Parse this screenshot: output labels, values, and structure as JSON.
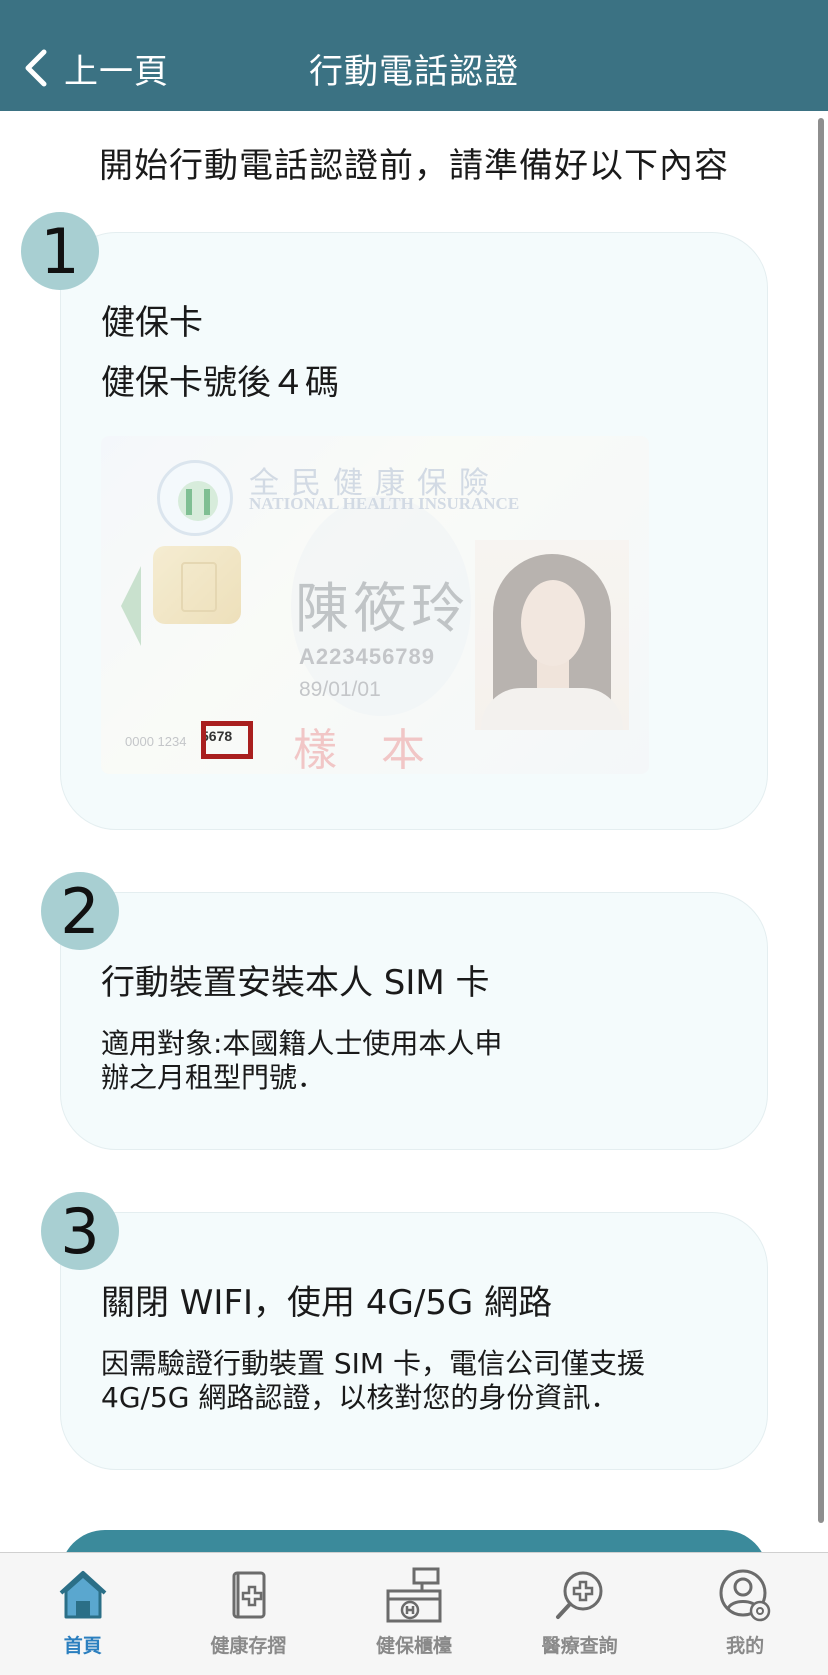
{
  "header": {
    "back_label": "上一頁",
    "title": "行動電話認證"
  },
  "intro": "開始行動電話認證前，請準備好以下內容",
  "steps": [
    {
      "number": "1",
      "title": "健保卡",
      "subtitle": "健保卡號後４碼"
    },
    {
      "number": "2",
      "title": "行動裝置安裝本人 SIM 卡",
      "desc_line1": "適用對象:本國籍人士使用本人申",
      "desc_line2": "辦之月租型門號．"
    },
    {
      "number": "3",
      "title": "關閉 WIFI，使用 4G/5G 網路",
      "desc_line1": "因需驗證行動裝置 SIM 卡，電信公司僅支援",
      "desc_line2": "4G/5G 網路認證，以核對您的身份資訊．"
    }
  ],
  "sample_card": {
    "org_cn": "全民健康保險",
    "org_en": "NATIONAL HEALTH INSURANCE",
    "name": "陳筱玲",
    "id_number": "A223456789",
    "dob": "89/01/01",
    "card_number_prefix": "0000 1234",
    "card_number_last4": "5678",
    "sample_mark": "樣本"
  },
  "tabs": [
    {
      "label": "首頁",
      "icon": "home-icon",
      "active": true
    },
    {
      "label": "健康存摺",
      "icon": "health-passbook-icon",
      "active": false
    },
    {
      "label": "健保櫃檯",
      "icon": "counter-icon",
      "active": false
    },
    {
      "label": "醫療查詢",
      "icon": "medical-search-icon",
      "active": false
    },
    {
      "label": "我的",
      "icon": "profile-settings-icon",
      "active": false
    }
  ],
  "colors": {
    "header": "#3b7283",
    "accent_blue": "#2b7fbf",
    "badge": "#a8cfd2",
    "card_bg": "#f4fbfc",
    "highlight_red": "#a91f1f"
  }
}
